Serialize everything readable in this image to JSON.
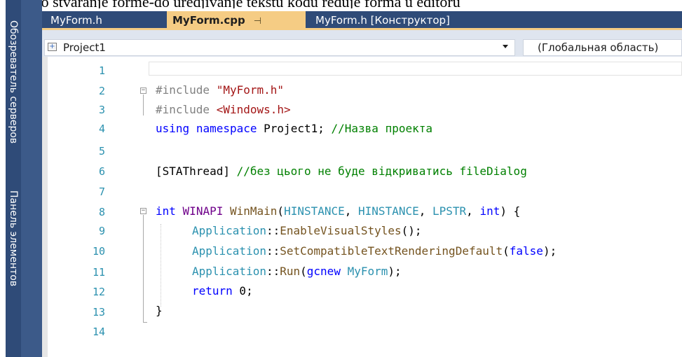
{
  "window": {
    "top_text_fragment": "pavleno stvaranje forme-do uredjivanje tekstu kodu reduje forma u editoru"
  },
  "side_panel": {
    "tabs": [
      {
        "label": "Обозреватель серверов"
      },
      {
        "label": "Панель элементов"
      }
    ]
  },
  "editor_tabs": [
    {
      "label": "MyForm.h",
      "active": false
    },
    {
      "label": "MyForm.cpp",
      "active": true,
      "pin": "⊣"
    },
    {
      "label": "MyForm.h [Конструктор]",
      "active": false
    }
  ],
  "navigation": {
    "project_combo": {
      "value": "Project1"
    },
    "scope_combo": {
      "value": "(Глобальная область)"
    }
  },
  "code_lines": [
    {
      "number": "1"
    },
    {
      "number": "2"
    },
    {
      "number": "3"
    },
    {
      "number": "4"
    },
    {
      "number": "5"
    },
    {
      "number": "6"
    },
    {
      "number": "7"
    },
    {
      "number": "8"
    },
    {
      "number": "9"
    },
    {
      "number": "10"
    },
    {
      "number": "11"
    },
    {
      "number": "12"
    },
    {
      "number": "13"
    },
    {
      "number": "14"
    }
  ],
  "code": {
    "l2": {
      "directive": "#include",
      "path": "\"MyForm.h\""
    },
    "l3": {
      "directive": "#include",
      "path": "<Windows.h>"
    },
    "l4": {
      "kw1": "using",
      "kw2": "namespace",
      "ident": "Project1;",
      "comment": "//Назва проекта"
    },
    "l6": {
      "attr": "[STAThread]",
      "comment": "//без цього не буде відкриватись fileDialog"
    },
    "l8": {
      "kw": "int",
      "macro": "WINAPI",
      "fn": "WinMain",
      "open": "(",
      "t1": "HINSTANCE",
      "c1": ", ",
      "t2": "HINSTANCE",
      "c2": ", ",
      "t3": "LPSTR",
      "c3": ", ",
      "t4": "int",
      "close": ") {"
    },
    "l9": {
      "cls": "Application",
      "sep": "::",
      "fn": "EnableVisualStyles",
      "rest": "();"
    },
    "l10": {
      "cls": "Application",
      "sep": "::",
      "fn": "SetCompatibleTextRenderingDefault",
      "open": "(",
      "val": "false",
      "rest": ");"
    },
    "l11": {
      "cls": "Application",
      "sep": "::",
      "fn": "Run",
      "open": "(",
      "kw": "gcnew",
      "arg": "MyForm",
      "rest": ");"
    },
    "l12": {
      "kw": "return",
      "rest": " 0;"
    },
    "l13": {
      "brace": "}"
    }
  },
  "colors": {
    "ide_blue": "#2f4b78",
    "active_tab": "#f5cc84",
    "keyword": "#0000ff",
    "comment": "#008000",
    "string": "#a31515",
    "line_number": "#2b91af"
  }
}
